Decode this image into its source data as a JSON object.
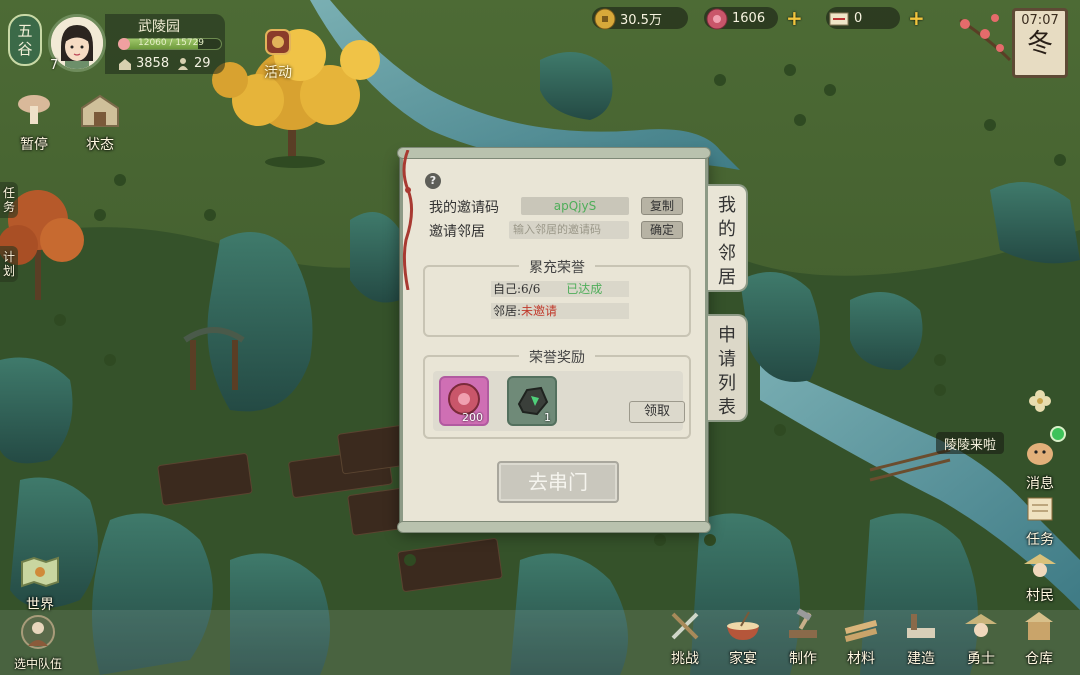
{
  "player": {
    "era_line1": "五",
    "era_line2": "谷",
    "level": "7",
    "name": "武陵园",
    "xp_text": "12060 / 15729",
    "xp_fraction": 0.77,
    "population": "3858",
    "villagers": "29"
  },
  "resources": {
    "coins": "30.5万",
    "gems": "1606",
    "tickets": "0"
  },
  "clock": {
    "time": "07:07",
    "season": "冬"
  },
  "left_buttons": {
    "pause": "暂停",
    "status": "状态",
    "tasks_tab": "任务",
    "plan_tab": "计划",
    "world": "世界",
    "team": "选中队伍"
  },
  "activity": {
    "label": "活动"
  },
  "right_buttons": {
    "message": "消息",
    "quest": "任务",
    "villager": "村民"
  },
  "chat": {
    "text": "陵陵来啦"
  },
  "bottom_bar": {
    "challenge": "挑战",
    "feast": "家宴",
    "craft": "制作",
    "materials": "材料",
    "build": "建造",
    "warrior": "勇士",
    "storage": "仓库"
  },
  "dialog": {
    "help_icon": "?",
    "my_code_label": "我的邀请码",
    "my_code_value": "apQjyS",
    "copy_button": "复制",
    "invite_label": "邀请邻居",
    "invite_placeholder": "输入邻居的邀请码",
    "confirm_button": "确定",
    "honor_title": "累充荣誉",
    "self_progress": "自己:6/6",
    "self_status": "已达成",
    "neighbor_label": "邻居:",
    "neighbor_status": "未邀请",
    "reward_title": "荣誉奖励",
    "reward_items": [
      {
        "name": "red-coin-item",
        "count": "200"
      },
      {
        "name": "jade-stone-item",
        "count": "1"
      }
    ],
    "claim_button": "领取",
    "visit_button": "去串门"
  },
  "tabs": {
    "my_neighbor": "我的邻居",
    "apply_list": "申请列表"
  },
  "colors": {
    "accent_green": "#4fae5a",
    "status_red": "#c0392b",
    "plus_gold": "#f2c53d",
    "notify_green": "#3ec25a"
  }
}
